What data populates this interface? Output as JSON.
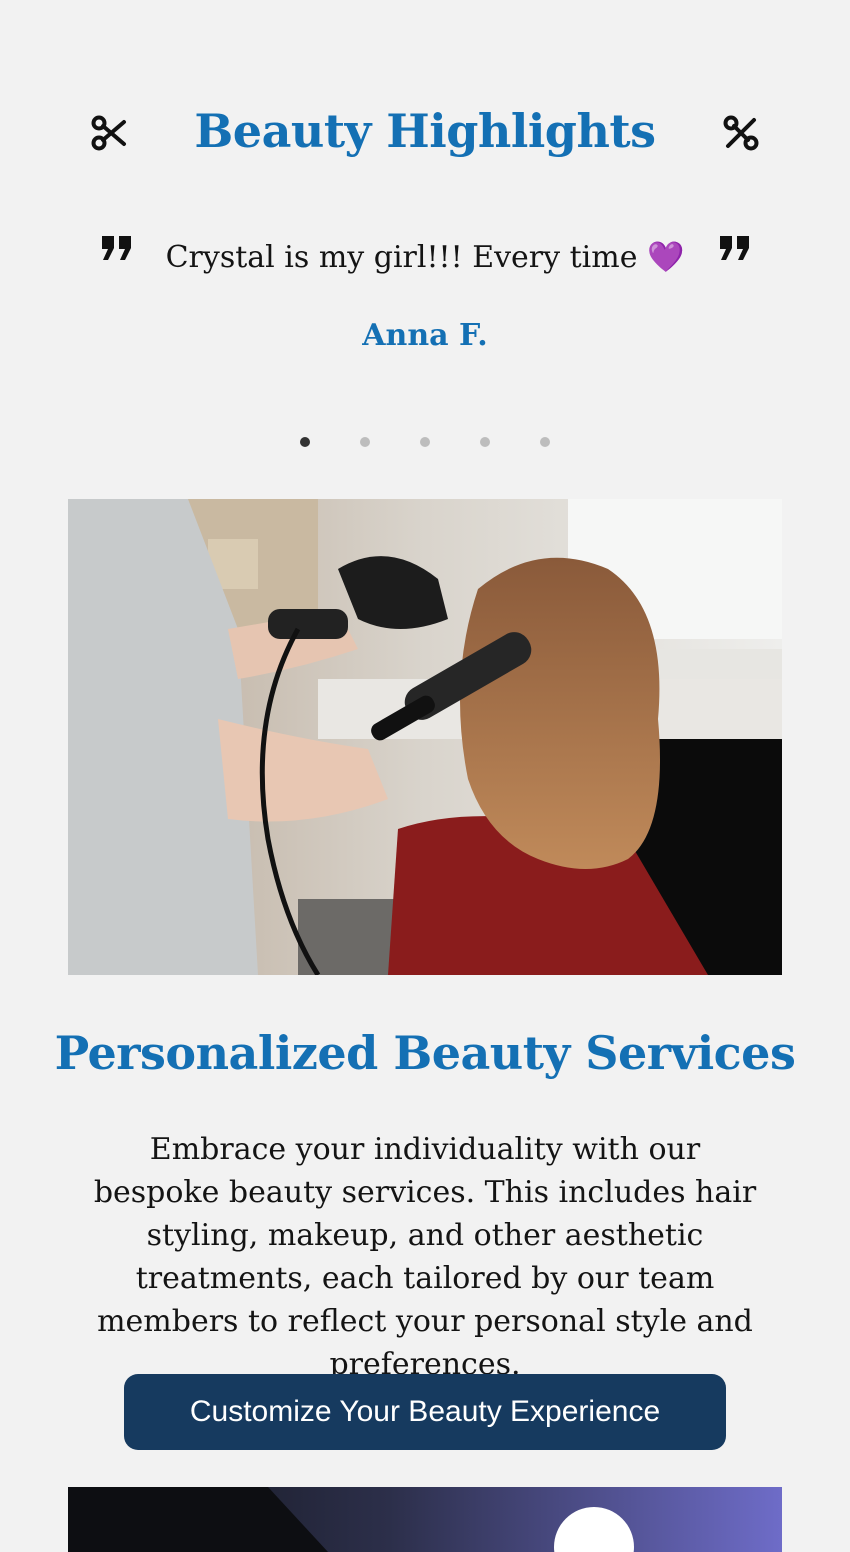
{
  "header": {
    "title": "Beauty Highlights",
    "left_icon": "scissors-icon",
    "right_icon": "scissors-open-icon"
  },
  "testimonial": {
    "quote": "Crystal is my girl!!! Every time",
    "emoji": "💜",
    "author": "Anna F.",
    "quote_icon": "quote-icon"
  },
  "carousel": {
    "total_dots": 5,
    "active_index": 0
  },
  "services": {
    "title": "Personalized Beauty Services",
    "description": "Embrace your individuality with our bespoke beauty services. This includes hair styling, makeup, and other aesthetic treatments, each tailored by our team members to reflect your personal style and preferences.",
    "button_label": "Customize Your Beauty Experience"
  },
  "colors": {
    "accent": "#1470b4",
    "button": "#163a5f",
    "background": "#f2f2f2"
  }
}
